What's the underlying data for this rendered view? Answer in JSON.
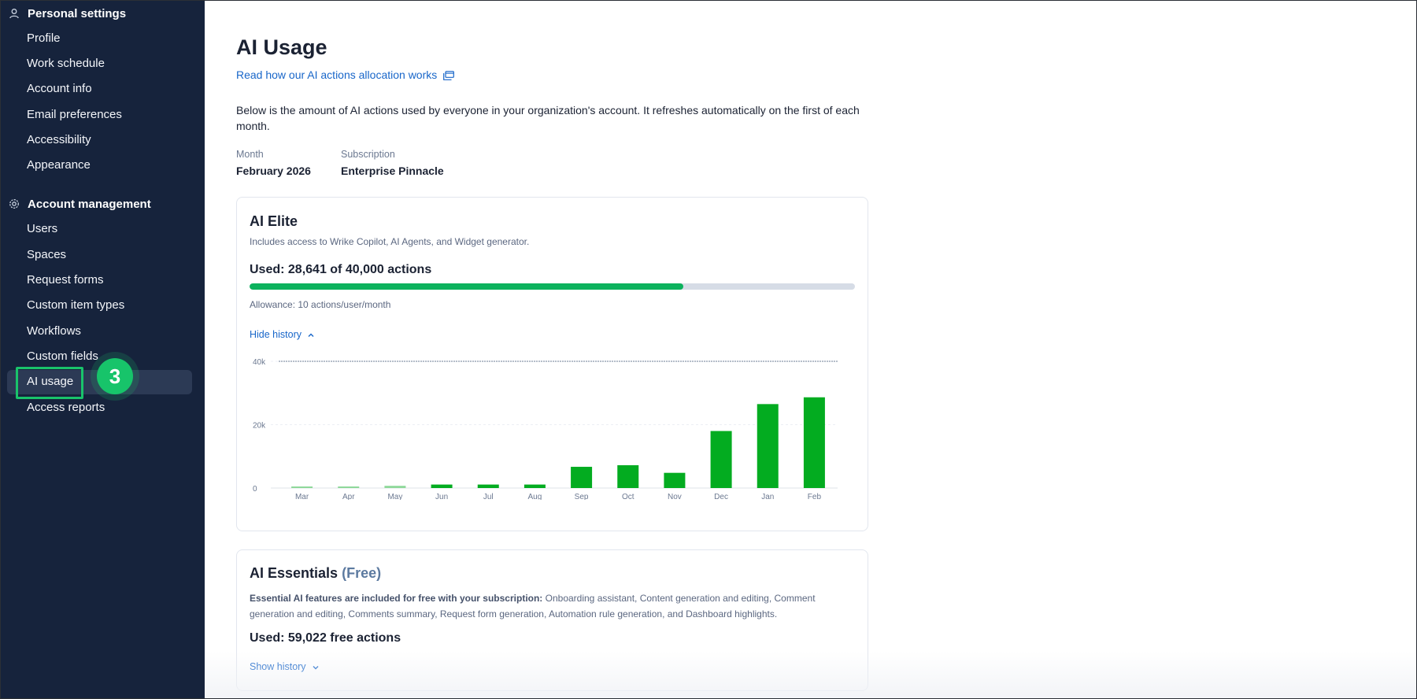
{
  "sidebar": {
    "personal": {
      "title": "Personal settings",
      "icon": "person-icon",
      "items": [
        "Profile",
        "Work schedule",
        "Account info",
        "Email preferences",
        "Accessibility",
        "Appearance"
      ]
    },
    "account": {
      "title": "Account management",
      "icon": "gear-icon",
      "items": [
        "Users",
        "Spaces",
        "Request forms",
        "Custom item types",
        "Workflows",
        "Custom fields",
        "AI usage",
        "Access reports"
      ]
    },
    "active_item": "AI usage",
    "step_badge": "3"
  },
  "main": {
    "title": "AI Usage",
    "help_link": "Read how our AI actions allocation works",
    "description": "Below is the amount of AI actions used by everyone in your organization's account. It refreshes automatically on the first of each month.",
    "month": {
      "label": "Month",
      "value": "February 2026"
    },
    "subscription": {
      "label": "Subscription",
      "value": "Enterprise Pinnacle"
    },
    "elite": {
      "title": "AI Elite",
      "subtitle": "Includes access to Wrike Copilot, AI Agents, and Widget generator.",
      "used_text": "Used: 28,641 of 40,000 actions",
      "used": 28641,
      "limit": 40000,
      "allowance": "Allowance: 10 actions/user/month",
      "history_toggle": "Hide history"
    },
    "essentials": {
      "title": "AI Essentials",
      "title_suffix": "(Free)",
      "desc_bold": "Essential AI features are included for free with your subscription:",
      "desc_rest": " Onboarding assistant, Content generation and editing, Comment generation and editing, Comments summary, Request form generation, Automation rule generation, and Dashboard highlights.",
      "used_text": "Used: 59,022 free actions",
      "history_toggle": "Show history"
    }
  },
  "colors": {
    "sidebar_bg": "#16233c",
    "accent_green": "#0cb25d",
    "bar_green": "#03ac20",
    "bar_light_green": "#8fd89a",
    "link_blue": "#1866c9",
    "badge_green": "#17c46a"
  },
  "chart_data": {
    "type": "bar",
    "categories": [
      "Mar",
      "Apr",
      "May",
      "Jun",
      "Jul",
      "Aug",
      "Sep",
      "Oct",
      "Nov",
      "Dec",
      "Jan",
      "Feb"
    ],
    "values": [
      250,
      300,
      700,
      1100,
      1100,
      1100,
      6700,
      7200,
      4800,
      18000,
      26500,
      28641
    ],
    "y_ticks": [
      "0",
      "20k",
      "40k"
    ],
    "ylim": [
      0,
      40000
    ],
    "limit_line": 40000
  }
}
